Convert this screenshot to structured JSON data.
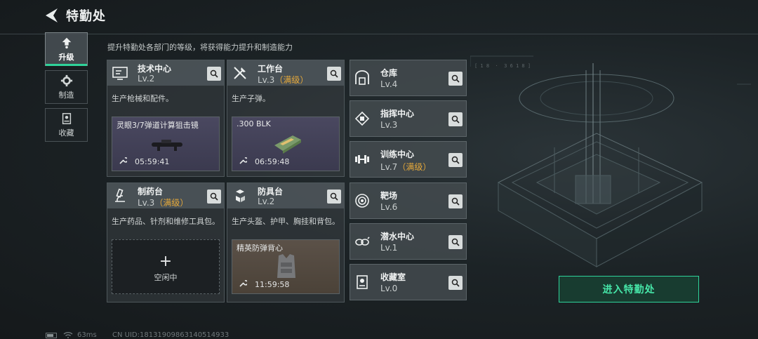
{
  "header": {
    "title": "特勤处",
    "subtitle": "提升特勤处各部门的等级，将获得能力提升和制造能力"
  },
  "nav": [
    {
      "label": "升级",
      "icon": "upgrade-icon",
      "active": true
    },
    {
      "label": "制造",
      "icon": "gear-icon",
      "active": false
    },
    {
      "label": "收藏",
      "icon": "collection-icon",
      "active": false
    }
  ],
  "cards": [
    {
      "name": "技术中心",
      "level": "Lv.2",
      "max": "",
      "desc": "生产枪械和配件。",
      "slot": {
        "item": "灵眼3/7弹道计算狙击镜",
        "timer": "05:59:41"
      }
    },
    {
      "name": "工作台",
      "level": "Lv.3",
      "max": "（满级）",
      "desc": "生产子弹。",
      "slot": {
        "item": ".300 BLK",
        "timer": "06:59:48"
      }
    },
    {
      "name": "制药台",
      "level": "Lv.3",
      "max": "（满级）",
      "desc": "生产药品、针剂和维修工具包。",
      "slot": {
        "plus": "+",
        "idle": "空闲中"
      }
    },
    {
      "name": "防具台",
      "level": "Lv.2",
      "max": "",
      "desc": "生产头盔、护甲、胸挂和背包。",
      "slot": {
        "item": "精英防弹背心",
        "timer": "11:59:58"
      }
    }
  ],
  "departments": [
    {
      "name": "仓库",
      "level": "Lv.4",
      "max": "",
      "icon": "warehouse-icon"
    },
    {
      "name": "指挥中心",
      "level": "Lv.3",
      "max": "",
      "icon": "command-chip-icon"
    },
    {
      "name": "训练中心",
      "level": "Lv.7",
      "max": "（满级）",
      "icon": "dumbbell-icon"
    },
    {
      "name": "靶场",
      "level": "Lv.6",
      "max": "",
      "icon": "target-icon"
    },
    {
      "name": "潜水中心",
      "level": "Lv.1",
      "max": "",
      "icon": "diving-mask-icon"
    },
    {
      "name": "收藏室",
      "level": "Lv.0",
      "max": "",
      "icon": "collection-room-icon"
    }
  ],
  "enter_button": "进入特勤处",
  "status": {
    "ping": "63ms",
    "uid": "CN UID:18131909863140514933"
  },
  "colors": {
    "accent": "#2fd39a",
    "max_level": "#e6a93a"
  }
}
